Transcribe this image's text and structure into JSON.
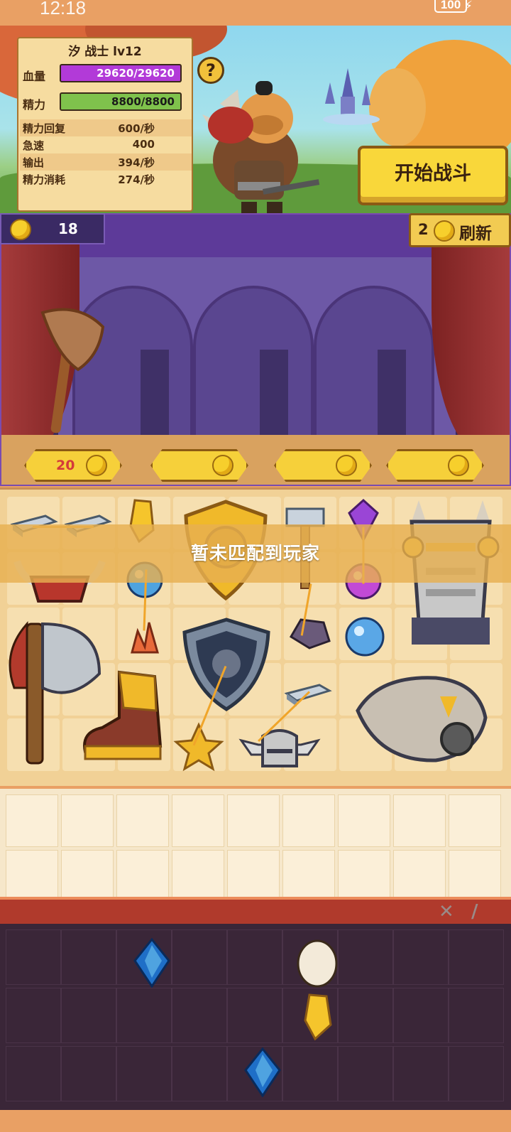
{
  "status_bar": {
    "time": "12:18",
    "battery": "100"
  },
  "hero": {
    "name_level": "汐 战士 lv12",
    "hp_label": "血量",
    "hp_value": "29620/29620",
    "hp_fraction": 1.0,
    "energy_label": "精力",
    "energy_value": "8800/8800",
    "energy_fraction": 1.0,
    "stats": [
      {
        "label": "精力回复",
        "value": "600/秒"
      },
      {
        "label": "急速",
        "value": "400"
      },
      {
        "label": "输出",
        "value": "394/秒"
      },
      {
        "label": "精力消耗",
        "value": "274/秒"
      }
    ],
    "help_label": "?"
  },
  "start_button": "开始战斗",
  "shop": {
    "coins": "18",
    "refresh_cost": "2",
    "refresh_label": "刷新",
    "prices": [
      "20",
      "",
      "",
      ""
    ]
  },
  "match_toast": "暂未匹配到玩家",
  "colors": {
    "hp": "#b23ad8",
    "energy": "#7fc24c",
    "accent": "#f9d73a",
    "price_text": "#d43a3a"
  },
  "items_icons": [
    "axe-icon",
    "iron-ingot-icon",
    "gold-crystal-icon",
    "golden-shield-icon",
    "hammer-icon",
    "amethyst-icon",
    "spiked-armor-icon",
    "horned-helmet-icon",
    "blue-orb-icon",
    "fire-crystal-icon",
    "wolf-shield-icon",
    "stone-icon",
    "great-axe-icon",
    "golden-boot-icon",
    "gold-badge-icon",
    "knight-helmet-icon",
    "gauntlet-icon",
    "sapphire-icon",
    "egg-icon"
  ]
}
